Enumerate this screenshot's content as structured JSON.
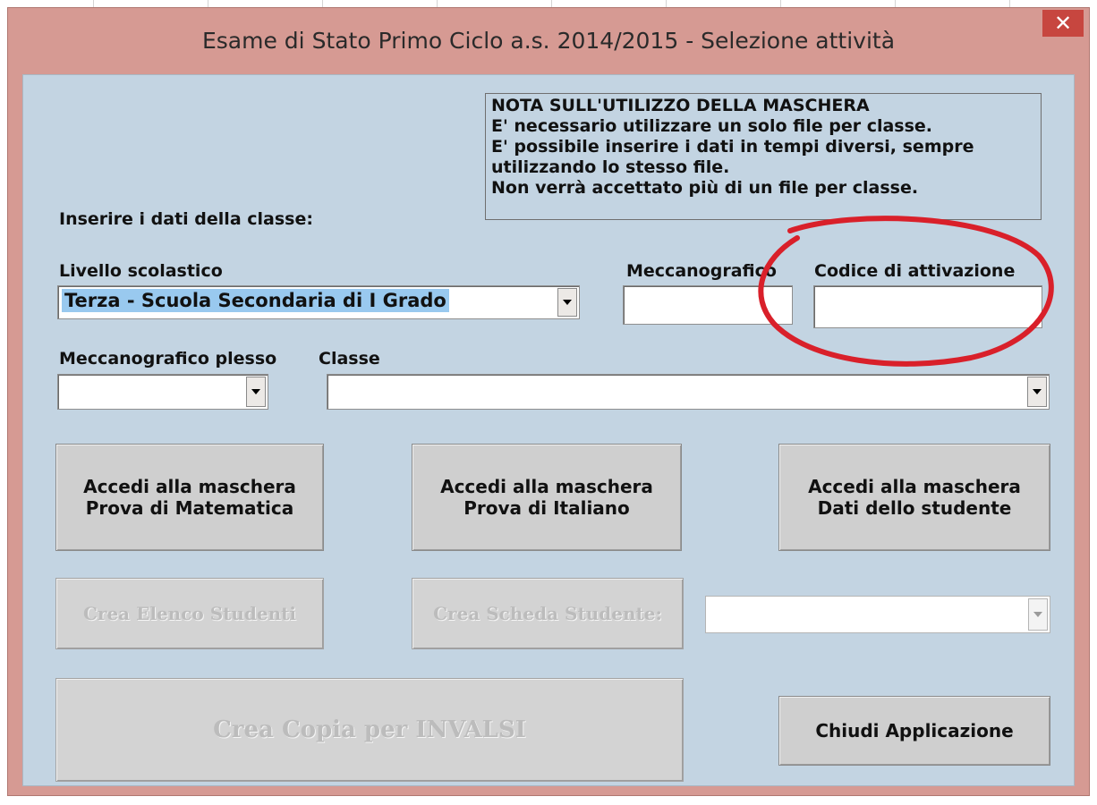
{
  "window": {
    "title": "Esame di Stato Primo Ciclo a.s. 2014/2015 - Selezione attività",
    "close_glyph": "✕"
  },
  "note": {
    "lines": [
      "NOTA SULL'UTILIZZO DELLA MASCHERA",
      "E' necessario utilizzare un solo file per classe.",
      "E' possibile inserire i dati in tempi diversi, sempre",
      "utilizzando lo stesso file.",
      "Non verrà accettato più di un file per classe."
    ]
  },
  "form": {
    "section_label": "Inserire i dati della classe:",
    "livello_label": "Livello scolastico",
    "livello_value": "Terza - Scuola Secondaria di I Grado",
    "meccanografico_label": "Meccanografico",
    "meccanografico_value": "",
    "codice_label": "Codice di attivazione",
    "codice_value": "",
    "plesso_label": "Meccanografico plesso",
    "plesso_value": "",
    "classe_label": "Classe",
    "classe_value": "",
    "scheda_value": ""
  },
  "buttons": {
    "matematica": [
      "Accedi alla maschera",
      "Prova di Matematica"
    ],
    "italiano": [
      "Accedi alla maschera",
      "Prova di Italiano"
    ],
    "studente": [
      "Accedi alla maschera",
      "Dati dello studente"
    ],
    "elenco": "Crea Elenco Studenti",
    "scheda": "Crea Scheda Studente:",
    "invalsi": "Crea Copia per INVALSI",
    "chiudi": "Chiudi Applicazione"
  },
  "colors": {
    "dialog_frame": "#d69a93",
    "client_bg": "#c3d4e2",
    "selection": "#99c9ef",
    "close_button": "#c7463f",
    "annotation_red": "#d9202a"
  },
  "icons": {
    "close": "close-icon",
    "dropdown": "chevron-down-icon"
  }
}
